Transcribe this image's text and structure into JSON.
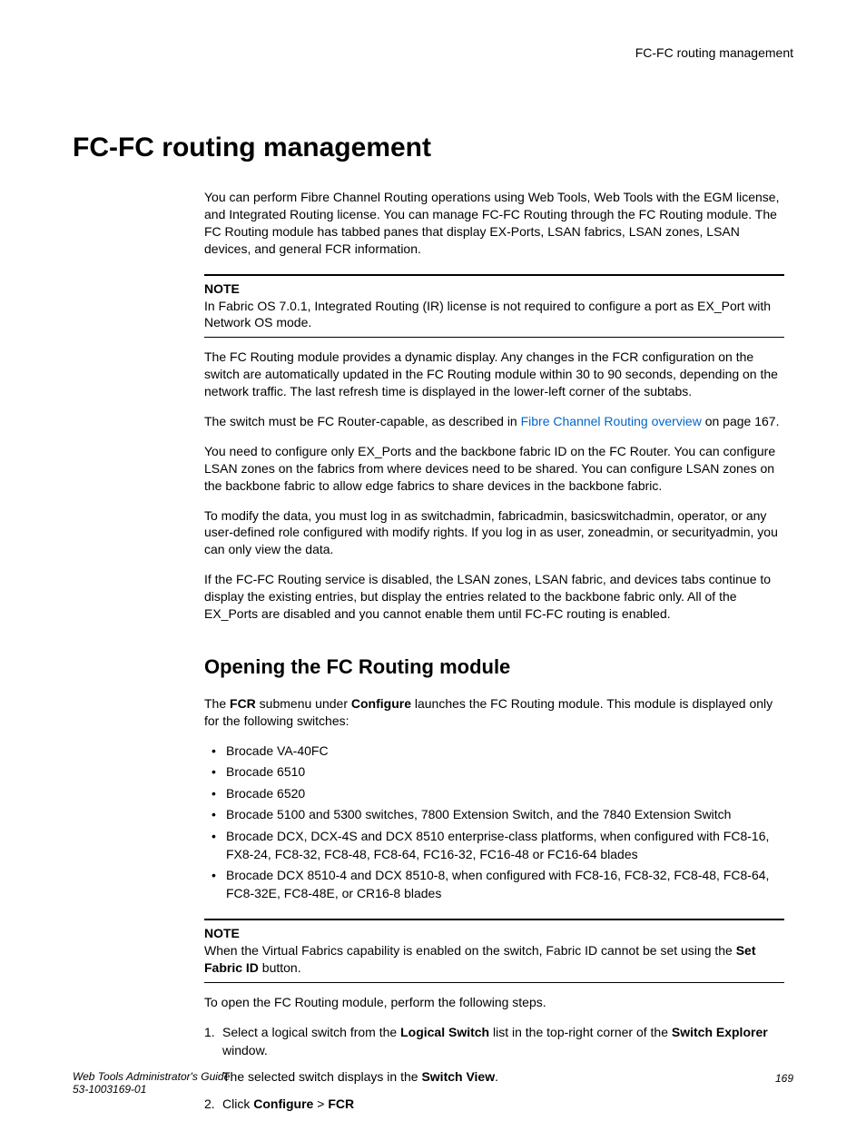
{
  "header": {
    "section": "FC-FC routing management"
  },
  "title": "FC-FC routing management",
  "intro": "You can perform Fibre Channel Routing operations using Web Tools, Web Tools with the EGM license, and Integrated Routing license. You can manage FC-FC Routing through the FC Routing module. The FC Routing module has tabbed panes that display EX-Ports, LSAN fabrics, LSAN zones, LSAN devices, and general FCR information.",
  "note1": {
    "label": "NOTE",
    "text": "In Fabric OS 7.0.1, Integrated Routing (IR) license is not required to configure a port as EX_Port with Network OS mode."
  },
  "para1": "The FC Routing module provides a dynamic display. Any changes in the FCR configuration on the switch are automatically updated in the FC Routing module within 30 to 90 seconds, depending on the network traffic. The last refresh time is displayed in the lower-left corner of the subtabs.",
  "para2_pre": "The switch must be FC Router-capable, as described in ",
  "para2_link": "Fibre Channel Routing overview",
  "para2_post": " on page 167.",
  "para3": "You need to configure only EX_Ports and the backbone fabric ID on the FC Router. You can configure LSAN zones on the fabrics from where devices need to be shared. You can configure LSAN zones on the backbone fabric to allow edge fabrics to share devices in the backbone fabric.",
  "para4": "To modify the data, you must log in as switchadmin, fabricadmin, basicswitchadmin, operator, or any user-defined role configured with modify rights. If you log in as user, zoneadmin, or securityadmin, you can only view the data.",
  "para5": "If the FC-FC Routing service is disabled, the LSAN zones, LSAN fabric, and devices tabs continue to display the existing entries, but display the entries related to the backbone fabric only. All of the EX_Ports are disabled and you cannot enable them until FC-FC routing is enabled.",
  "subheading": "Opening the FC Routing module",
  "sub_para_pre": "The ",
  "sub_para_b1": "FCR",
  "sub_para_mid": " submenu under ",
  "sub_para_b2": "Configure",
  "sub_para_post": " launches the FC Routing module. This module is displayed only for the following switches:",
  "switches": [
    "Brocade VA-40FC",
    "Brocade 6510",
    "Brocade 6520",
    "Brocade 5100 and 5300 switches, 7800 Extension Switch, and the 7840 Extension Switch",
    "Brocade DCX, DCX-4S and DCX 8510 enterprise-class platforms, when configured with FC8-16, FX8-24, FC8-32, FC8-48, FC8-64, FC16-32, FC16-48 or FC16-64 blades",
    "Brocade DCX 8510-4 and DCX 8510-8, when configured with FC8-16, FC8-32, FC8-48, FC8-64, FC8-32E, FC8-48E, or CR16-8 blades"
  ],
  "note2": {
    "label": "NOTE",
    "text_pre": "When the Virtual Fabrics capability is enabled on the switch, Fabric ID cannot be set using the ",
    "text_b": "Set Fabric ID",
    "text_post": " button."
  },
  "steps_intro": "To open the FC Routing module, perform the following steps.",
  "step1_pre": "Select a logical switch from the ",
  "step1_b1": "Logical Switch",
  "step1_mid": " list in the top-right corner of the ",
  "step1_b2": "Switch Explorer",
  "step1_post": " window.",
  "step1_sub_pre": "The selected switch displays in the ",
  "step1_sub_b": "Switch View",
  "step1_sub_post": ".",
  "step2_pre": "Click ",
  "step2_b1": "Configure ",
  "step2_mid": " > ",
  "step2_b2": "FCR",
  "footer": {
    "title": "Web Tools Administrator's Guide",
    "docnum": "53-1003169-01",
    "page": "169"
  }
}
